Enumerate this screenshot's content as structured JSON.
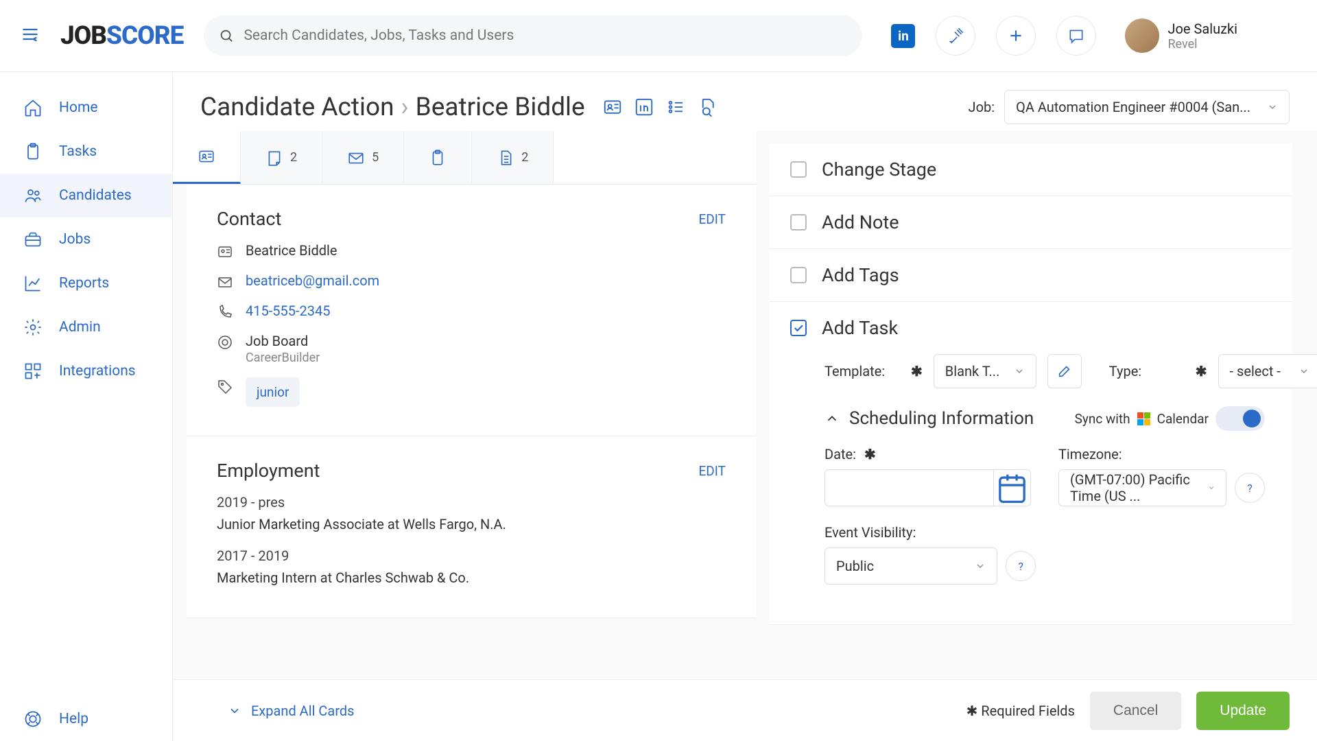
{
  "header": {
    "logo1": "JOB",
    "logo2": "SCORE",
    "search_placeholder": "Search Candidates, Jobs, Tasks and Users",
    "user_name": "Joe Saluzki",
    "user_org": "Revel"
  },
  "sidebar": {
    "items": [
      {
        "label": "Home"
      },
      {
        "label": "Tasks"
      },
      {
        "label": "Candidates"
      },
      {
        "label": "Jobs"
      },
      {
        "label": "Reports"
      },
      {
        "label": "Admin"
      },
      {
        "label": "Integrations"
      }
    ],
    "help": "Help"
  },
  "breadcrumb": {
    "a": "Candidate Action",
    "b": "Beatrice Biddle"
  },
  "job_picker": {
    "label": "Job:",
    "value": "QA Automation Engineer #0004 (San..."
  },
  "tabs": {
    "notes_count": "2",
    "mail_count": "5",
    "docs_count": "2"
  },
  "contact": {
    "title": "Contact",
    "edit": "EDIT",
    "name": "Beatrice Biddle",
    "email": "beatriceb@gmail.com",
    "phone": "415-555-2345",
    "source_label": "Job Board",
    "source_sub": "CareerBuilder",
    "tag": "junior"
  },
  "employment": {
    "title": "Employment",
    "edit": "EDIT",
    "items": [
      {
        "period": "2019 - pres",
        "desc": "Junior Marketing Associate at Wells Fargo, N.A."
      },
      {
        "period": "2017 - 2019",
        "desc": "Marketing Intern at Charles Schwab & Co."
      }
    ]
  },
  "actions": {
    "change_stage": "Change Stage",
    "add_note": "Add Note",
    "add_tags": "Add Tags",
    "add_task": "Add Task"
  },
  "task_form": {
    "template_label": "Template:",
    "template_value": "Blank T...",
    "type_label": "Type:",
    "type_value": "- select -",
    "sched_title": "Scheduling Information",
    "sync_label": "Sync with",
    "sync_cal": "Calendar",
    "date_label": "Date:",
    "tz_label": "Timezone:",
    "tz_value": "(GMT-07:00) Pacific Time (US ...",
    "visibility_label": "Event Visibility:",
    "visibility_value": "Public"
  },
  "footer": {
    "expand": "Expand All Cards",
    "required": "Required Fields",
    "cancel": "Cancel",
    "update": "Update"
  }
}
